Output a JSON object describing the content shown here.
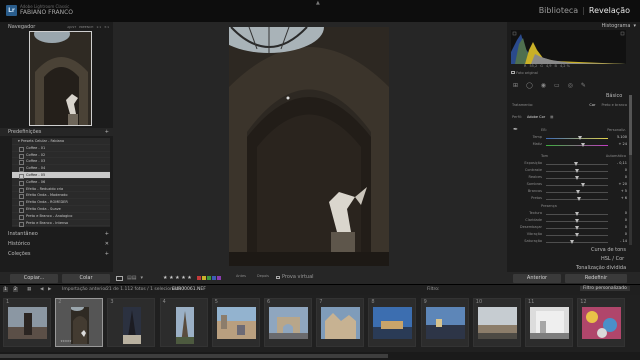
{
  "app": {
    "logo": "Lr",
    "name": "Adobe Lightroom Classic",
    "user": "FABIANO FRANCO"
  },
  "modules": {
    "library": "Biblioteca",
    "sep": "|",
    "develop": "Revelação"
  },
  "left": {
    "navigator": {
      "title": "Navegador",
      "zoom": [
        "AJUST",
        "PREENCH",
        "1:1",
        "3:1"
      ]
    },
    "presets": {
      "title": "Predefinições",
      "folder": "Presets Celular - Fabiano",
      "items": [
        "Coffee - 01",
        "Coffee - 02",
        "Coffee - 03",
        "Coffee - 04",
        "Coffee - 05",
        "Coffee - 06",
        "Efeito - Reduzido cria",
        "Efeito Onda - Moderado",
        "Efeito Onda - ROMEDER",
        "Efeito Onda - Suave",
        "Preto e Branco - Analogico",
        "Preto e Branco - Intenso"
      ],
      "selected_index": 4
    },
    "snapshots": "Instantâneo",
    "history": "Histórico",
    "collections": "Coleções",
    "copy": "Copiar...",
    "paste": "Colar"
  },
  "toolbar": {
    "stars": "★ ★ ★ ★ ★",
    "before_after": "Antes",
    "after": "Depois",
    "soft_proof": "Prova virtual"
  },
  "right": {
    "histogram": "Histograma",
    "readout": [
      "R",
      "55,2",
      "G",
      "4,9",
      "B",
      "4,2 %"
    ],
    "original": "Foto original",
    "basic": "Básico",
    "treatment_label": "Tratamento:",
    "treatment_color": "Cor",
    "treatment_bw": "Preto e branco",
    "profile_label": "Perfil:",
    "profile_value": "Adobe Cor",
    "wb_label": "EB:",
    "wb_value": "Personaliz.",
    "wb_sliders": [
      {
        "name": "Temp",
        "value": "5.100"
      },
      {
        "name": "Matiz",
        "value": "+ 24"
      }
    ],
    "tone_label": "Tom",
    "tone_auto": "Automático",
    "tone_sliders": [
      {
        "name": "Exposição",
        "value": "- 0,11"
      },
      {
        "name": "Contraste",
        "value": "0"
      },
      {
        "name": "Realces",
        "value": "0"
      },
      {
        "name": "Sombras",
        "value": "+ 20"
      },
      {
        "name": "Brancos",
        "value": "+ 5"
      },
      {
        "name": "Pretos",
        "value": "+ 6"
      }
    ],
    "presence_label": "Presença",
    "presence_sliders": [
      {
        "name": "Textura",
        "value": "0"
      },
      {
        "name": "Claridade",
        "value": "0"
      },
      {
        "name": "Desembaçar",
        "value": "0"
      },
      {
        "name": "Vibração",
        "value": "0"
      },
      {
        "name": "Saturação",
        "value": "- 14"
      }
    ],
    "sections": [
      "Curva de tons",
      "HSL / Cor",
      "Tonalização dividida"
    ],
    "previous": "Anterior",
    "reset": "Redefinir"
  },
  "filmstrip": {
    "nums": [
      "1",
      "2"
    ],
    "source": "Importação anterior",
    "count": "21 de 1.112 fotos / 1 selecionada /",
    "file": "EUR00061.NEF",
    "filter_label": "Filtro:",
    "filter_value": "Filtro personalizado",
    "thumbs": [
      "1",
      "2",
      "3",
      "4",
      "5",
      "6",
      "7",
      "8",
      "9",
      "10",
      "11",
      "12"
    ],
    "selected": 1,
    "stars": "★★★★★"
  }
}
